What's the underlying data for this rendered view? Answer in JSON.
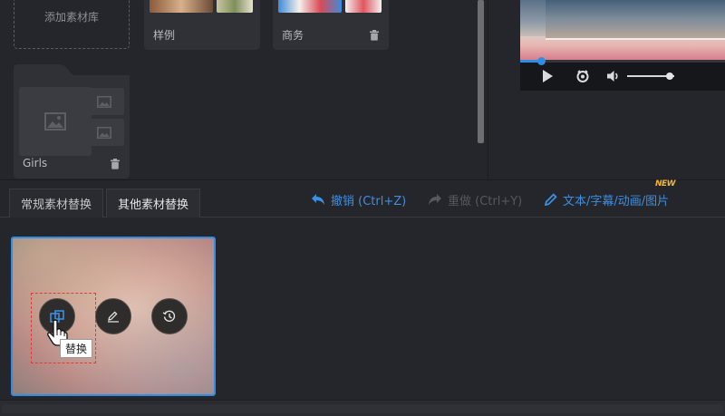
{
  "library": {
    "add_label": "添加素材库",
    "cards": [
      {
        "label": "样例"
      },
      {
        "label": "商务"
      }
    ],
    "folder": {
      "label": "Girls"
    }
  },
  "player": {
    "progress": 0.1,
    "volume": 0.9
  },
  "tabs": [
    {
      "label": "常规素材替换",
      "active": false
    },
    {
      "label": "其他素材替换",
      "active": true
    }
  ],
  "toolbar": {
    "undo_label": "撤销 (Ctrl+Z)",
    "redo_label": "重做 (Ctrl+Y)",
    "text_label": "文本/字幕/动画/图片",
    "new_badge": "NEW"
  },
  "media": {
    "tooltip": "替换"
  },
  "colors": {
    "accent": "#2f8de4",
    "background": "#25262b",
    "selection_outline": "#e03a3a",
    "new_badge": "#f2b632"
  }
}
